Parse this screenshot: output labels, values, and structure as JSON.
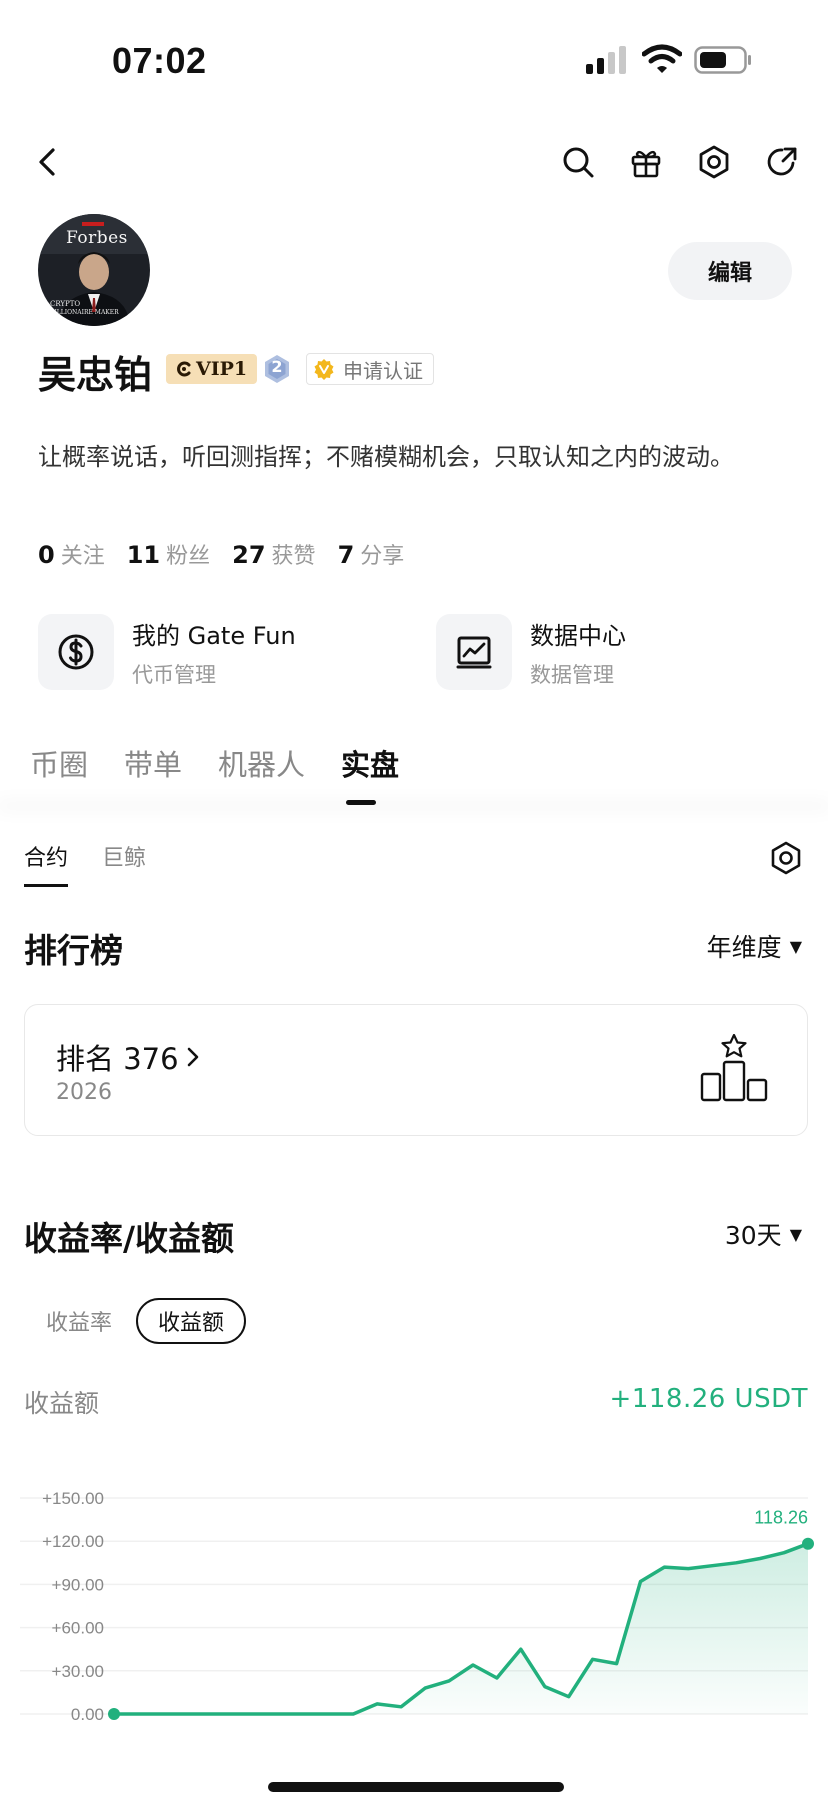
{
  "status_bar": {
    "time": "07:02"
  },
  "nav": {
    "icons": [
      "back-icon",
      "search-icon",
      "gift-icon",
      "settings-icon",
      "share-icon"
    ]
  },
  "profile": {
    "avatar_text": "Forbes",
    "edit_label": "编辑",
    "name": "吴忠铂",
    "vip_label": "VIP1",
    "level": "2",
    "verify_label": "申请认证",
    "bio": "让概率说话，听回测指挥；不赌模糊机会，只取认知之内的波动。",
    "stats": [
      {
        "value": "0",
        "label": "关注"
      },
      {
        "value": "11",
        "label": "粉丝"
      },
      {
        "value": "27",
        "label": "获赞"
      },
      {
        "value": "7",
        "label": "分享"
      }
    ]
  },
  "tools": [
    {
      "title": "我的 Gate Fun",
      "subtitle": "代币管理",
      "icon": "dollar-icon"
    },
    {
      "title": "数据中心",
      "subtitle": "数据管理",
      "icon": "chart-icon"
    }
  ],
  "main_tabs": [
    "币圈",
    "带单",
    "机器人",
    "实盘"
  ],
  "main_tab_active": 3,
  "sub_tabs": [
    "合约",
    "巨鲸"
  ],
  "sub_tab_active": 0,
  "ranking": {
    "title": "排行榜",
    "period": "年维度",
    "rank_label": "排名 376",
    "year": "2026"
  },
  "pnl": {
    "title": "收益率/收益额",
    "period": "30天",
    "toggle": [
      "收益率",
      "收益额"
    ],
    "toggle_active": 1,
    "label": "收益额",
    "value": "+118.26 USDT"
  },
  "chart_data": {
    "type": "area",
    "y_ticks": [
      "+150.00",
      "+120.00",
      "+90.00",
      "+60.00",
      "+30.00",
      "0.00"
    ],
    "ylim": [
      0,
      150
    ],
    "last_label": "118.26",
    "line_color": "#22b07d",
    "values": [
      0,
      0,
      0,
      0,
      0,
      0,
      0,
      0,
      0,
      0,
      0,
      7,
      5,
      18,
      23,
      34,
      25,
      45,
      19,
      12,
      38,
      35,
      92,
      102,
      101,
      103,
      105,
      108,
      112,
      118.26
    ]
  }
}
